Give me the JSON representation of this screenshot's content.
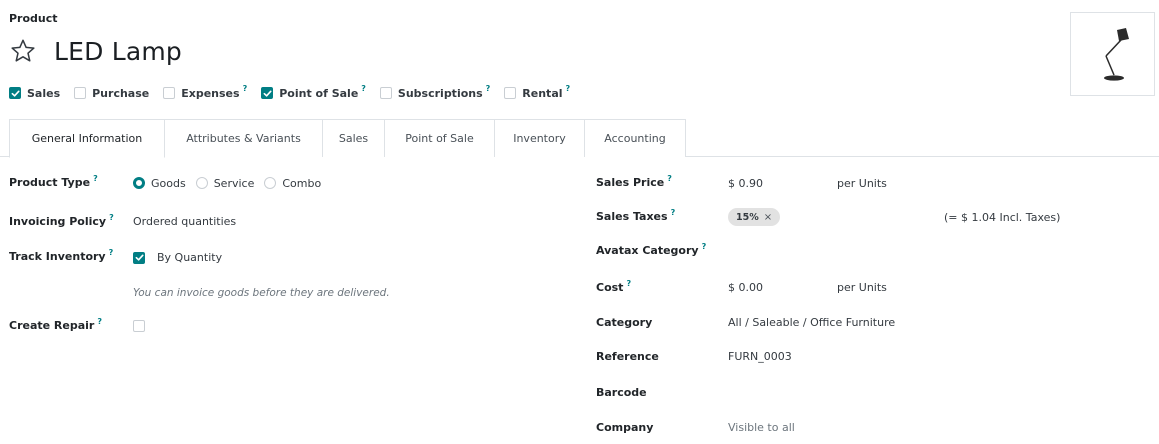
{
  "breadcrumb": "Product",
  "product": {
    "name": "LED Lamp",
    "favorite": false
  },
  "options": [
    {
      "label": "Sales",
      "checked": true,
      "help": false
    },
    {
      "label": "Purchase",
      "checked": false,
      "help": false
    },
    {
      "label": "Expenses",
      "checked": false,
      "help": true
    },
    {
      "label": "Point of Sale",
      "checked": true,
      "help": true
    },
    {
      "label": "Subscriptions",
      "checked": false,
      "help": true
    },
    {
      "label": "Rental",
      "checked": false,
      "help": true
    }
  ],
  "help_mark": "?",
  "tabs": [
    {
      "label": "General Information",
      "active": true
    },
    {
      "label": "Attributes & Variants",
      "active": false
    },
    {
      "label": "Sales",
      "active": false
    },
    {
      "label": "Point of Sale",
      "active": false
    },
    {
      "label": "Inventory",
      "active": false
    },
    {
      "label": "Accounting",
      "active": false
    }
  ],
  "left": {
    "product_type": {
      "label": "Product Type",
      "options": [
        "Goods",
        "Service",
        "Combo"
      ],
      "selected": "Goods"
    },
    "invoicing_policy": {
      "label": "Invoicing Policy",
      "value": "Ordered quantities"
    },
    "track_inventory": {
      "label": "Track Inventory",
      "checked": true,
      "value": "By Quantity"
    },
    "hint": "You can invoice goods before they are delivered.",
    "create_repair": {
      "label": "Create Repair",
      "checked": false
    }
  },
  "right": {
    "sales_price": {
      "label": "Sales Price",
      "value": "$ 0.90",
      "unit": "per Units"
    },
    "sales_taxes": {
      "label": "Sales Taxes",
      "tag": "15%",
      "tag_remove": "×",
      "incl": "(= $ 1.04 Incl. Taxes)"
    },
    "avatax_category": {
      "label": "Avatax Category"
    },
    "cost": {
      "label": "Cost",
      "value": "$ 0.00",
      "unit": "per Units"
    },
    "category": {
      "label": "Category",
      "value": "All / Saleable / Office Furniture"
    },
    "reference": {
      "label": "Reference",
      "value": "FURN_0003"
    },
    "barcode": {
      "label": "Barcode"
    },
    "company": {
      "label": "Company",
      "value": "Visible to all"
    }
  },
  "colors": {
    "accent": "#017e84",
    "border": "#dee2e6",
    "tag_bg": "#e2e2e2"
  },
  "icons": {
    "favorite": "star-outline-icon",
    "checked": "check-icon"
  }
}
